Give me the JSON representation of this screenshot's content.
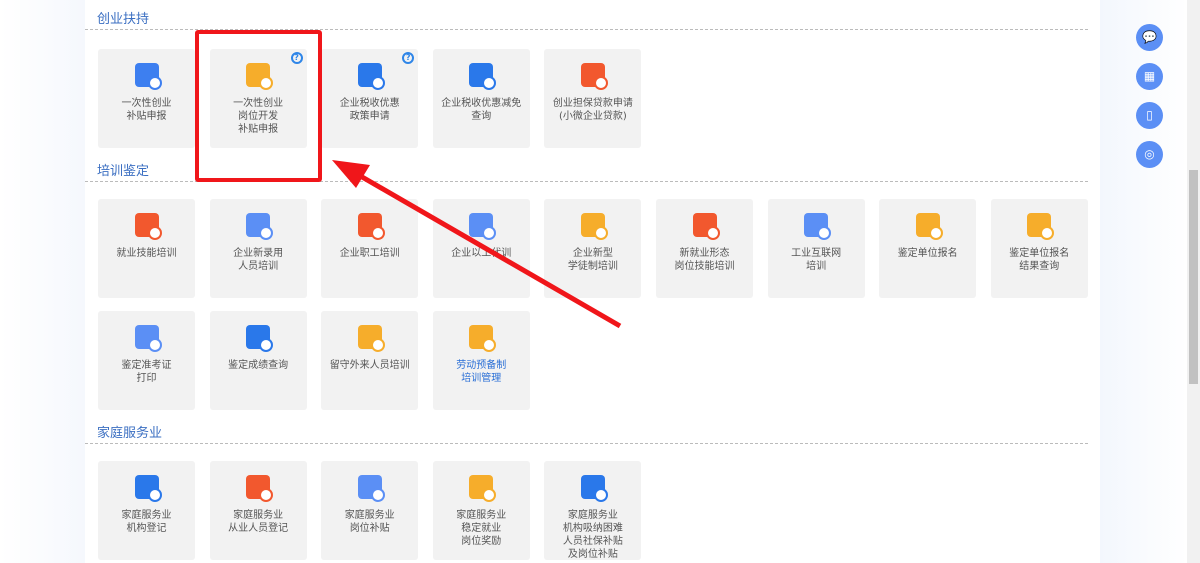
{
  "sections": [
    {
      "title": "创业扶持",
      "items": [
        {
          "label": "一次性创业\n补贴申报",
          "color": "#3d7ff0",
          "help": false
        },
        {
          "label": "一次性创业\n岗位开发\n补贴申报",
          "color": "#f6ad2b",
          "help": true
        },
        {
          "label": "企业税收优惠\n政策申请",
          "color": "#2a78ea",
          "help": true
        },
        {
          "label": "企业税收优惠减免\n查询",
          "color": "#2a78ea",
          "help": false
        },
        {
          "label": "创业担保贷款申请\n(小微企业贷款)",
          "color": "#f2582e",
          "help": false
        }
      ]
    },
    {
      "title": "培训鉴定",
      "items": [
        {
          "label": "就业技能培训",
          "color": "#f2582e"
        },
        {
          "label": "企业新录用\n人员培训",
          "color": "#5b8ff5"
        },
        {
          "label": "企业职工培训",
          "color": "#f2582e"
        },
        {
          "label": "企业以工代训",
          "color": "#5b8ff5"
        },
        {
          "label": "企业新型\n学徒制培训",
          "color": "#f6ad2b"
        },
        {
          "label": "新就业形态\n岗位技能培训",
          "color": "#f2582e"
        },
        {
          "label": "工业互联网\n培训",
          "color": "#5b8ff5"
        },
        {
          "label": "鉴定单位报名",
          "color": "#f6ad2b"
        },
        {
          "label": "鉴定单位报名\n结果查询",
          "color": "#f6ad2b"
        },
        {
          "label": "鉴定准考证\n打印",
          "color": "#5b8ff5"
        },
        {
          "label": "鉴定成绩查询",
          "color": "#2a78ea"
        },
        {
          "label": "留守外来人员培训",
          "color": "#f6ad2b"
        },
        {
          "label": "劳动预备制\n培训管理",
          "color": "#f6ad2b",
          "blue": true
        }
      ]
    },
    {
      "title": "家庭服务业",
      "items": [
        {
          "label": "家庭服务业\n机构登记",
          "color": "#2a78ea"
        },
        {
          "label": "家庭服务业\n从业人员登记",
          "color": "#f2582e"
        },
        {
          "label": "家庭服务业\n岗位补贴",
          "color": "#5b8ff5"
        },
        {
          "label": "家庭服务业\n稳定就业\n岗位奖励",
          "color": "#f6ad2b"
        },
        {
          "label": "家庭服务业\n机构吸纳困难\n人员社保补贴\n及岗位补贴",
          "color": "#2a78ea"
        }
      ]
    }
  ],
  "help_label": "?",
  "side_icons": [
    "wechat-icon",
    "app-icon",
    "mobile-icon",
    "service-icon"
  ],
  "side_glyphs": [
    "💬",
    "▦",
    "▯",
    "◎"
  ]
}
